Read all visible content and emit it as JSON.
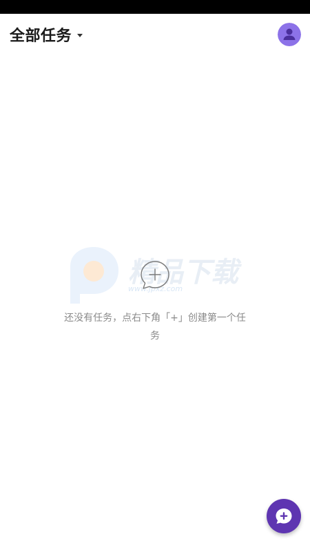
{
  "header": {
    "title": "全部任务"
  },
  "empty_state": {
    "message": "还没有任务，点右下角「+」创建第一个任务"
  },
  "watermark": {
    "text": "精品下载",
    "subtext": "www.jpxz.com"
  },
  "colors": {
    "accent": "#5e35b1",
    "avatar_bg": "#8c72e8",
    "avatar_glyph": "#4a2f9c",
    "status_bar": "#000000",
    "muted_text": "#8a8a8a"
  },
  "icons": {
    "title_menu": "caret-down-icon",
    "avatar": "person-icon",
    "empty": "chat-bubble-plus-icon",
    "fab": "chat-bubble-plus-icon"
  }
}
